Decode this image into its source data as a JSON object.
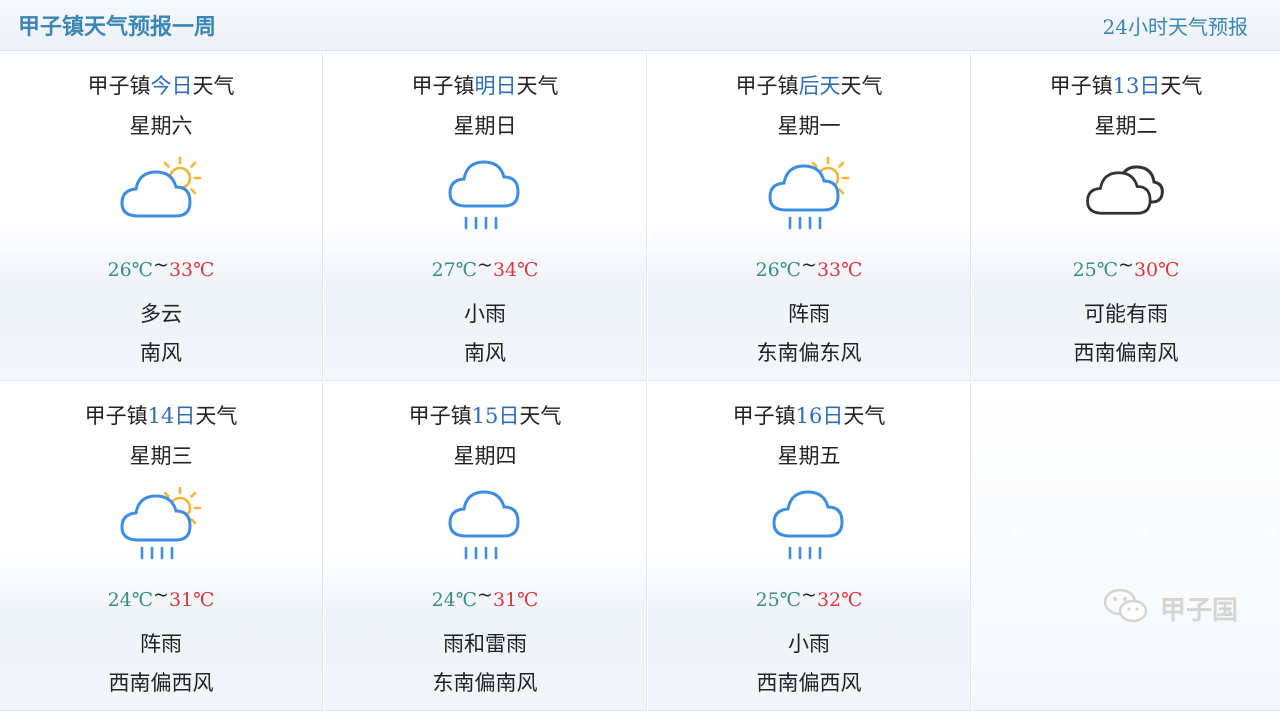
{
  "header": {
    "title": "甲子镇天气预报一周",
    "link": "24小时天气预报"
  },
  "town": "甲子镇",
  "suffix": "天气",
  "days": [
    {
      "day_label": "今日",
      "weekday": "星期六",
      "icon": "partly-cloudy-icon",
      "low": "26℃",
      "sep": "~",
      "high": "33℃",
      "condition": "多云",
      "wind": "南风"
    },
    {
      "day_label": "明日",
      "weekday": "星期日",
      "icon": "rain-icon",
      "low": "27℃",
      "sep": "~",
      "high": "34℃",
      "condition": "小雨",
      "wind": "南风"
    },
    {
      "day_label": "后天",
      "weekday": "星期一",
      "icon": "sun-shower-icon",
      "low": "26℃",
      "sep": "~",
      "high": "33℃",
      "condition": "阵雨",
      "wind": "东南偏东风"
    },
    {
      "day_label": "13日",
      "weekday": "星期二",
      "icon": "cloudy-icon",
      "low": "25℃",
      "sep": "~",
      "high": "30℃",
      "condition": "可能有雨",
      "wind": "西南偏南风"
    },
    {
      "day_label": "14日",
      "weekday": "星期三",
      "icon": "sun-shower-icon",
      "low": "24℃",
      "sep": "~",
      "high": "31℃",
      "condition": "阵雨",
      "wind": "西南偏西风"
    },
    {
      "day_label": "15日",
      "weekday": "星期四",
      "icon": "rain-icon",
      "low": "24℃",
      "sep": "~",
      "high": "31℃",
      "condition": "雨和雷雨",
      "wind": "东南偏南风"
    },
    {
      "day_label": "16日",
      "weekday": "星期五",
      "icon": "rain-icon",
      "low": "25℃",
      "sep": "~",
      "high": "32℃",
      "condition": "小雨",
      "wind": "西南偏西风"
    }
  ],
  "watermark": {
    "text": "甲子国",
    "icon": "wechat-icon"
  },
  "colors": {
    "accent": "#3a86b5",
    "low_temp": "#3a8c8c",
    "high_temp": "#d9363e",
    "icon_blue": "#3f8de0",
    "sun": "#f5b335"
  }
}
